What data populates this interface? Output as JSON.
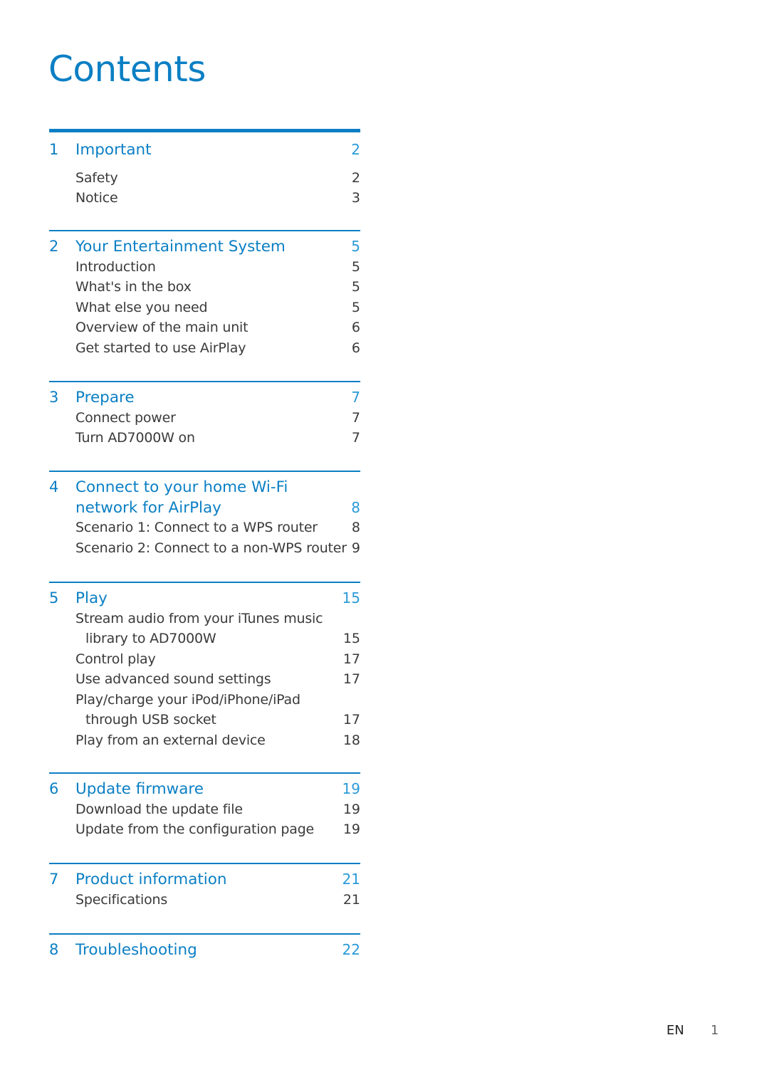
{
  "page_title": "Contents",
  "sections": [
    {
      "number": "1",
      "title_lines": [
        "Important"
      ],
      "page": "2",
      "items": [
        {
          "text": "Safety",
          "page": "2"
        },
        {
          "text": "Notice",
          "page": "3"
        }
      ]
    },
    {
      "number": "2",
      "title_lines": [
        "Your Entertainment System"
      ],
      "page": "5",
      "items": [
        {
          "text": "Introduction",
          "page": "5"
        },
        {
          "text": "What's in the box",
          "page": "5"
        },
        {
          "text": "What else you need",
          "page": "5"
        },
        {
          "text": "Overview of the main unit",
          "page": "6"
        },
        {
          "text": "Get started to use AirPlay",
          "page": "6"
        }
      ]
    },
    {
      "number": "3",
      "title_lines": [
        "Prepare"
      ],
      "page": "7",
      "items": [
        {
          "text": "Connect power",
          "page": "7"
        },
        {
          "text": "Turn AD7000W on",
          "page": "7"
        }
      ]
    },
    {
      "number": "4",
      "title_lines": [
        "Connect to your home Wi-Fi",
        "network for AirPlay"
      ],
      "page": "8",
      "items": [
        {
          "text": "Scenario 1: Connect to a WPS router",
          "page": "8"
        },
        {
          "text": "Scenario 2: Connect to a non-WPS router",
          "page": "9"
        }
      ]
    },
    {
      "number": "5",
      "title_lines": [
        "Play"
      ],
      "page": "15",
      "items": [
        {
          "text": "Stream audio from your iTunes music",
          "continuation": "library to AD7000W",
          "page": "15"
        },
        {
          "text": "Control play",
          "page": "17"
        },
        {
          "text": "Use advanced sound settings",
          "page": "17"
        },
        {
          "text": "Play/charge your iPod/iPhone/iPad",
          "continuation": "through USB socket",
          "page": "17"
        },
        {
          "text": "Play from an external device",
          "page": "18"
        }
      ]
    },
    {
      "number": "6",
      "title_lines": [
        "Update firmware"
      ],
      "page": "19",
      "items": [
        {
          "text": "Download the update file",
          "page": "19"
        },
        {
          "text": "Update from the configuration page",
          "page": "19"
        }
      ]
    },
    {
      "number": "7",
      "title_lines": [
        "Product information"
      ],
      "page": "21",
      "items": [
        {
          "text": "Specifications",
          "page": "21"
        }
      ]
    },
    {
      "number": "8",
      "title_lines": [
        "Troubleshooting"
      ],
      "page": "22",
      "items": []
    }
  ],
  "footer": {
    "language": "EN",
    "page_number": "1"
  }
}
